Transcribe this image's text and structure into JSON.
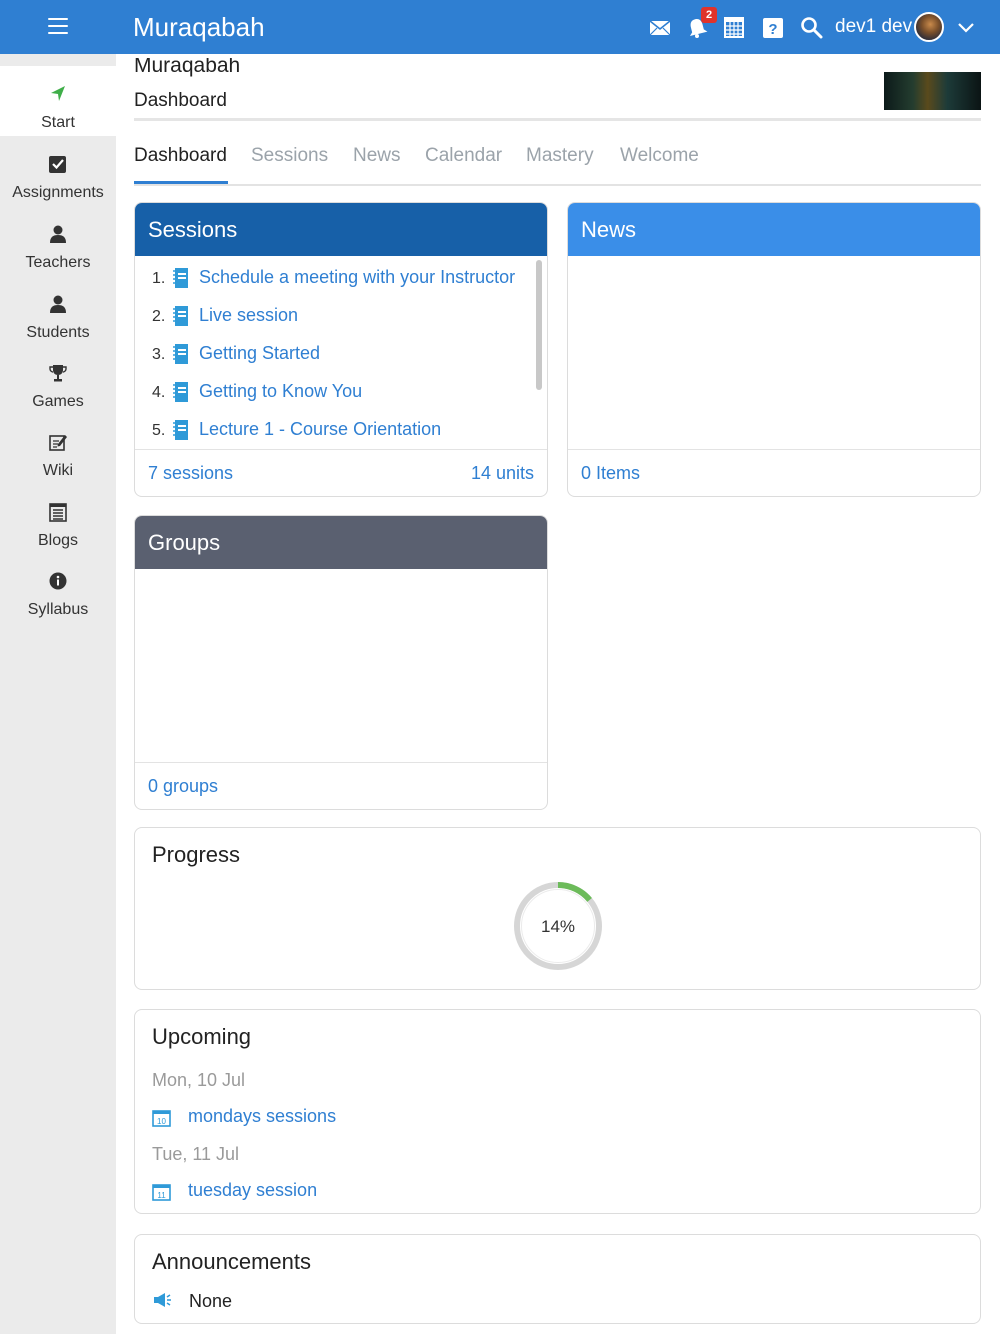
{
  "app": {
    "title": "Muraqabah"
  },
  "topbar": {
    "notification_count": "2",
    "username": "dev1 dev",
    "icons": [
      "menu-icon",
      "mail-icon",
      "bell-icon",
      "calendar-grid-icon",
      "help-icon",
      "search-icon",
      "chevron-down-icon"
    ]
  },
  "sidebar": {
    "items": [
      {
        "label": "Start",
        "icon": "location-arrow-icon",
        "active": true
      },
      {
        "label": "Assignments",
        "icon": "checkbox-icon"
      },
      {
        "label": "Teachers",
        "icon": "user-icon"
      },
      {
        "label": "Students",
        "icon": "user-icon"
      },
      {
        "label": "Games",
        "icon": "trophy-icon"
      },
      {
        "label": "Wiki",
        "icon": "edit-icon"
      },
      {
        "label": "Blogs",
        "icon": "list-icon"
      },
      {
        "label": "Syllabus",
        "icon": "info-icon"
      }
    ]
  },
  "page": {
    "title": "Muraqabah",
    "subtitle": "Dashboard"
  },
  "tabs": [
    "Dashboard",
    "Sessions",
    "News",
    "Calendar",
    "Mastery",
    "Welcome"
  ],
  "sessions_card": {
    "title": "Sessions",
    "items": [
      {
        "num": "1.",
        "label": "Schedule a meeting with your Instructor"
      },
      {
        "num": "2.",
        "label": "Live session"
      },
      {
        "num": "3.",
        "label": "Getting Started"
      },
      {
        "num": "4.",
        "label": "Getting to Know You"
      },
      {
        "num": "5.",
        "label": "Lecture 1 - Course Orientation"
      }
    ],
    "footer_left": "7 sessions",
    "footer_right": "14 units"
  },
  "news_card": {
    "title": "News",
    "footer": "0 Items"
  },
  "groups_card": {
    "title": "Groups",
    "footer": "0 groups"
  },
  "progress": {
    "title": "Progress",
    "value_label": "14%",
    "value": 0.14
  },
  "upcoming": {
    "title": "Upcoming",
    "days": [
      {
        "date": "Mon, 10 Jul",
        "events": [
          {
            "day_num": "10",
            "label": "mondays sessions"
          }
        ]
      },
      {
        "date": "Tue, 11 Jul",
        "events": [
          {
            "day_num": "11",
            "label": "tuesday session"
          }
        ]
      }
    ]
  },
  "announcements": {
    "title": "Announcements",
    "text": "None",
    "icon": "megaphone-icon"
  },
  "colors": {
    "primary": "#2f7fd2",
    "sessions_header": "#1760a8",
    "news_header": "#3a8ee8",
    "groups_header": "#5a6070",
    "progress_ring": "#6cbb5a",
    "badge": "#e0332b"
  }
}
